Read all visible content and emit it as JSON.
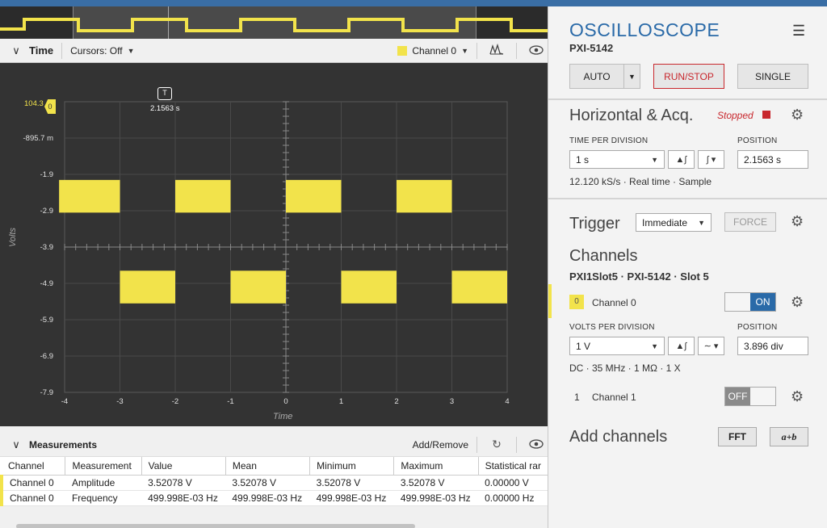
{
  "colors": {
    "accent": "#2a6aa8",
    "trace": "#f2e34b",
    "run_stop": "#c8272d",
    "plot_bg": "#333333"
  },
  "timebar": {
    "title": "Time",
    "cursors": "Cursors: Off",
    "channel": "Channel 0"
  },
  "plot": {
    "trigger_label": "T",
    "trigger_time": "2.1563 s",
    "y_axis_label": "Volts",
    "x_axis_label": "Time",
    "top_value": "104.3",
    "channel_badge": "0",
    "y_ticks": [
      "-895.7 m",
      "-1.9",
      "-2.9",
      "-3.9",
      "-4.9",
      "-5.9",
      "-6.9",
      "-7.9"
    ],
    "x_ticks": [
      "-4",
      "-3",
      "-2",
      "-1",
      "0",
      "1",
      "2",
      "3",
      "4"
    ]
  },
  "chart_data": {
    "type": "line",
    "xlabel": "Time",
    "ylabel": "Volts",
    "xlim": [
      -4,
      4
    ],
    "ylim": [
      -7.9,
      0.104
    ],
    "series": [
      {
        "values_high_band": [
          -2.05,
          -2.95
        ],
        "values_low_band": [
          -4.55,
          -5.45
        ],
        "edge_times": [
          -4.1,
          -3.0,
          -2.0,
          -1.0,
          0.0,
          1.0,
          2.0,
          3.0,
          4.0
        ],
        "first_level": "high_at_-4"
      }
    ]
  },
  "measurements": {
    "title": "Measurements",
    "add_remove": "Add/Remove",
    "columns": [
      "Channel",
      "Measurement",
      "Value",
      "Mean",
      "Minimum",
      "Maximum",
      "Statistical rar"
    ],
    "rows": [
      [
        "Channel 0",
        "Amplitude",
        "3.52078 V",
        "3.52078 V",
        "3.52078 V",
        "3.52078 V",
        "0.00000 V"
      ],
      [
        "Channel 0",
        "Frequency",
        "499.998E-03 Hz",
        "499.998E-03 Hz",
        "499.998E-03 Hz",
        "499.998E-03 Hz",
        "0.00000 Hz"
      ]
    ]
  },
  "panel": {
    "title": "OSCILLOSCOPE",
    "device": "PXI-5142",
    "auto": "AUTO",
    "run_stop": "RUN/STOP",
    "single": "SINGLE",
    "horizontal": {
      "title": "Horizontal & Acq.",
      "status": "Stopped",
      "tpd_label": "TIME PER DIVISION",
      "tpd_value": "1 s",
      "pos_label": "POSITION",
      "pos_value": "2.1563 s",
      "info": "12.120 kS/s  ·  Real time  ·  Sample"
    },
    "trigger": {
      "title": "Trigger",
      "mode": "Immediate",
      "force": "FORCE"
    },
    "channels": {
      "title": "Channels",
      "path": "PXI1Slot5  ·  PXI-5142  ·  Slot 5",
      "ch0": {
        "index": "0",
        "name": "Channel 0",
        "state": "ON"
      },
      "vpd_label": "VOLTS PER DIVISION",
      "vpd_value": "1 V",
      "pos_label": "POSITION",
      "pos_value": "3.896 div",
      "info": "DC  ·  35 MHz  ·  1 MΩ  ·  1 X",
      "ch1": {
        "index": "1",
        "name": "Channel 1",
        "state": "OFF"
      }
    },
    "add_channels": {
      "title": "Add channels",
      "fft": "FFT",
      "math": "a+b"
    }
  }
}
